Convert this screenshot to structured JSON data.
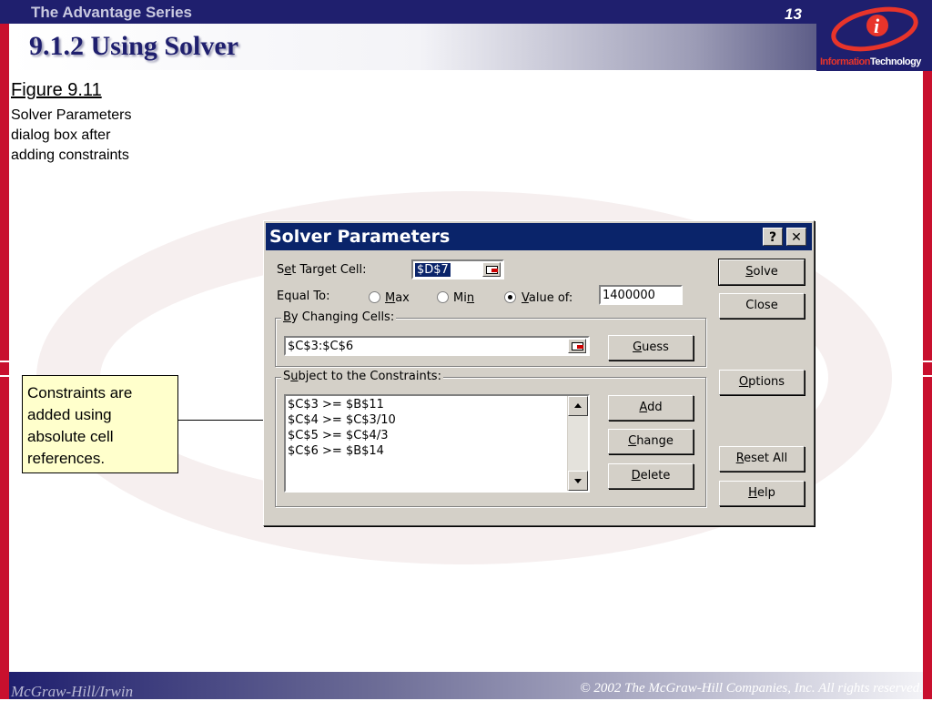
{
  "header": {
    "series": "The Advantage Series",
    "page_number": "13",
    "title": "9.1.2 Using Solver",
    "logo_text_a": "Information",
    "logo_text_b": "Technology"
  },
  "figure": {
    "label": "Figure 9.11",
    "caption": "Solver Parameters dialog box after adding constraints"
  },
  "callout": {
    "text": "Constraints are added using absolute cell references."
  },
  "footer": {
    "left": "McGraw-Hill/Irwin",
    "right": "© 2002  The McGraw-Hill Companies, Inc. All rights reserved."
  },
  "colors": {
    "navy": "#1f1f6e",
    "red_bar": "#c8102e",
    "dialog_gray": "#d4d0c8",
    "titlebar": "#0a246a",
    "callout_bg": "#ffffcc"
  },
  "dialog": {
    "title": "Solver Parameters",
    "help_button": "?",
    "close_button": "✕",
    "target_label_pre": "S",
    "target_label_u": "e",
    "target_label_post": "t Target Cell:",
    "target_value": "$D$7",
    "equal_to_label": "Equal To:",
    "radio_max_u": "M",
    "radio_max_post": "ax",
    "radio_min_pre": "Mi",
    "radio_min_u": "n",
    "radio_value_u": "V",
    "radio_value_post": "alue of:",
    "value_of": "1400000",
    "changing_label_u": "B",
    "changing_label_post": "y Changing Cells:",
    "changing_value": "$C$3:$C$6",
    "constraints_label_pre": "S",
    "constraints_label_u": "u",
    "constraints_label_post": "bject to the Constraints:",
    "constraints": [
      "$C$3 >= $B$11",
      "$C$4 >= $C$3/10",
      "$C$5 >= $C$4/3",
      "$C$6 >= $B$14"
    ],
    "buttons": {
      "solve_u": "S",
      "solve_post": "olve",
      "close": "Close",
      "options_u": "O",
      "options_post": "ptions",
      "reset_u": "R",
      "reset_post": "eset All",
      "help_u": "H",
      "help_post": "elp",
      "guess_u": "G",
      "guess_post": "uess",
      "add_u": "A",
      "add_post": "dd",
      "change_u": "C",
      "change_post": "hange",
      "delete_u": "D",
      "delete_post": "elete"
    }
  }
}
